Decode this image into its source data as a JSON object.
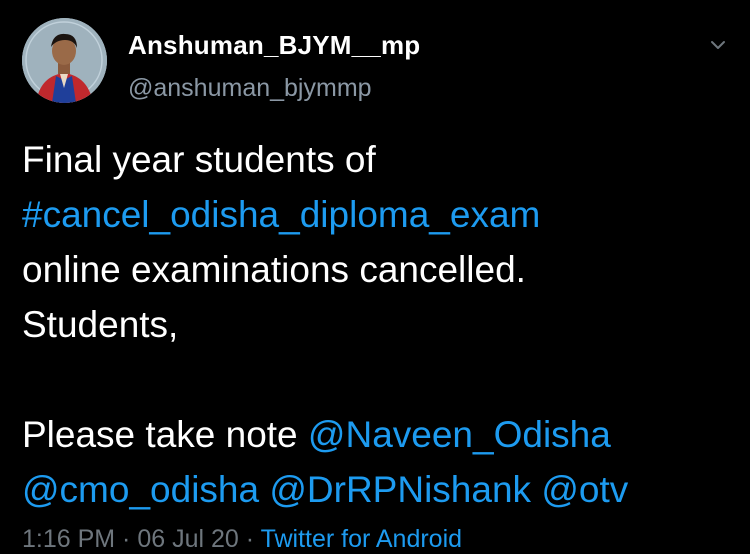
{
  "user": {
    "display_name": "Anshuman_BJYM__mp",
    "handle": "@anshuman_bjymmp"
  },
  "tweet": {
    "line1": "Final year students of",
    "hashtag": "#cancel_odisha_diploma_exam",
    "line3": "online examinations cancelled.",
    "line4": "Students,",
    "line6_text": "Please take note ",
    "mention1": "@Naveen_Odisha",
    "mention2": "@cmo_odisha",
    "mention3": "@DrRPNishank",
    "mention4": "@otv"
  },
  "meta": {
    "time": "1:16 PM",
    "date": "06 Jul 20",
    "separator": " · ",
    "source": "Twitter for Android"
  },
  "icons": {
    "menu": "chevron-down-icon"
  },
  "colors": {
    "background": "#000000",
    "link": "#1d9bf0",
    "text": "#ffffff",
    "secondary": "#8b98a5"
  }
}
